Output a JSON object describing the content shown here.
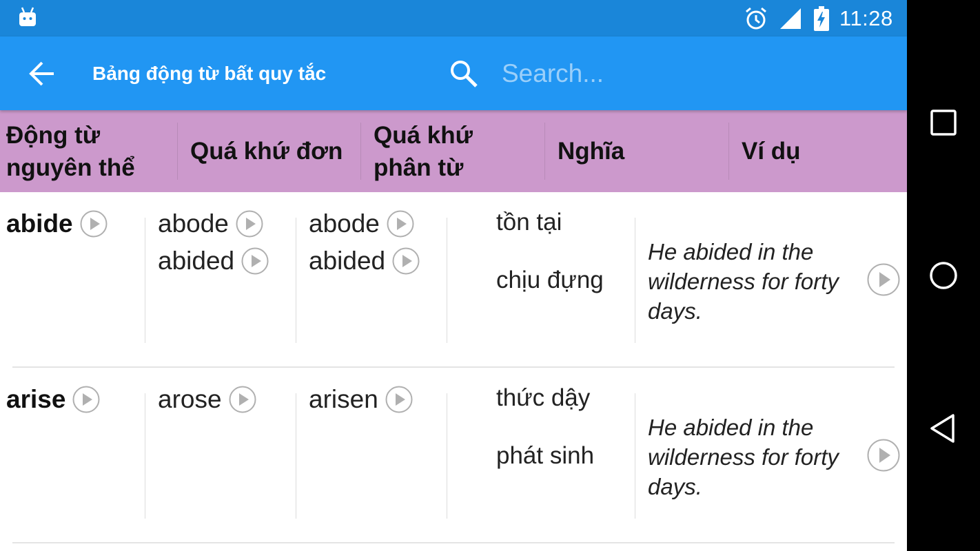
{
  "status_bar": {
    "time": "11:28",
    "icons": [
      "android-debug-icon",
      "alarm-icon",
      "signal-icon",
      "battery-charging-icon"
    ]
  },
  "app_bar": {
    "title": "Bảng động từ bất quy tắc",
    "search_placeholder": "Search..."
  },
  "table": {
    "headers": [
      {
        "line1": "Động từ",
        "line2": "nguyên thể"
      },
      {
        "line1": "Quá khứ đơn",
        "line2": ""
      },
      {
        "line1": "Quá khứ",
        "line2": "phân từ"
      },
      {
        "line1": "Nghĩa",
        "line2": ""
      },
      {
        "line1": "Ví dụ",
        "line2": ""
      }
    ],
    "rows": [
      {
        "base": "abide",
        "past_simple": [
          "abode",
          "abided"
        ],
        "past_participle": [
          "abode",
          "abided"
        ],
        "meanings": [
          "tồn tại",
          "chịu đựng"
        ],
        "example": [
          "He abided in the",
          "wilderness for forty",
          "days."
        ]
      },
      {
        "base": "arise",
        "past_simple": [
          "arose"
        ],
        "past_participle": [
          "arisen"
        ],
        "meanings": [
          "thức dậy",
          "phát sinh"
        ],
        "example": [
          "He abided in the",
          "wilderness for forty",
          "days."
        ]
      }
    ]
  },
  "nav_bar": {
    "buttons": [
      "recents-square-icon",
      "home-circle-icon",
      "back-triangle-icon"
    ]
  },
  "colors": {
    "status_bar": "#1a86d9",
    "app_bar": "#2196f3",
    "table_header": "#cc99cc",
    "play_icon": "#b0b0b0"
  }
}
